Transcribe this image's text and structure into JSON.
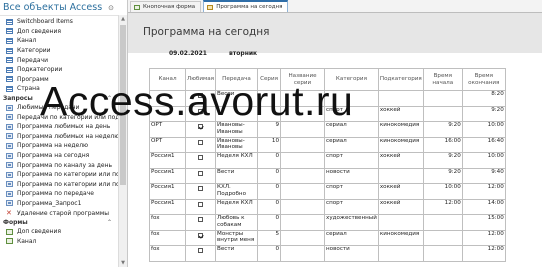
{
  "nav": {
    "header": "Все объекты Access",
    "items_top": [
      {
        "label": "Switchboard Items",
        "icon": "table-icon"
      },
      {
        "label": "Доп сведения",
        "icon": "table-icon"
      },
      {
        "label": "Канал",
        "icon": "table-icon"
      },
      {
        "label": "Категории",
        "icon": "table-icon"
      },
      {
        "label": "Передачи",
        "icon": "table-icon"
      },
      {
        "label": "Подкатегории",
        "icon": "table-icon"
      },
      {
        "label": "Программ",
        "icon": "table-icon"
      },
      {
        "label": "Страна",
        "icon": "table-icon"
      }
    ],
    "group_queries": "Запросы",
    "queries": [
      {
        "label": "Любимые передачи",
        "icon": "query-icon"
      },
      {
        "label": "Передачи по категории или подкате...",
        "icon": "query-icon"
      },
      {
        "label": "Программа любимых на день",
        "icon": "query-icon"
      },
      {
        "label": "Программа любимых на неделю",
        "icon": "query-icon"
      },
      {
        "label": "Программа на неделю",
        "icon": "query-icon"
      },
      {
        "label": "Программа на сегодня",
        "icon": "query-icon"
      },
      {
        "label": "Программа по каналу за день",
        "icon": "query-icon"
      },
      {
        "label": "Программа по категории или подкат...",
        "icon": "query-icon"
      },
      {
        "label": "Программа по категории или подкат...",
        "icon": "query-icon"
      },
      {
        "label": "Программа по передаче",
        "icon": "query-icon"
      },
      {
        "label": "Программа_Запрос1",
        "icon": "query-icon"
      },
      {
        "label": "Удаление старой программы",
        "icon": "delete-query-icon"
      }
    ],
    "group_forms": "Формы",
    "forms": [
      {
        "label": "Доп сведения",
        "icon": "form-icon"
      },
      {
        "label": "Канал",
        "icon": "form-icon"
      }
    ]
  },
  "tabs": [
    {
      "label": "Кнопочная форма",
      "active": false
    },
    {
      "label": "Программа на сегодня",
      "active": true
    }
  ],
  "form": {
    "title": "Программа на сегодня",
    "date": "09.02.2021",
    "day": "вторник"
  },
  "grid": {
    "headers": [
      "Канал",
      "Любимая",
      "Передача",
      "Серия",
      "Название серии",
      "Категория",
      "Подкатегория",
      "Время начала",
      "Время окончания"
    ],
    "rows": [
      {
        "channel": "",
        "fav": false,
        "show": "Вести",
        "episode": "",
        "episode_name": "",
        "category": "",
        "subcategory": "",
        "start": "",
        "end": "8:20"
      },
      {
        "channel": "",
        "fav": true,
        "show": "",
        "episode": "",
        "episode_name": "",
        "category": "спорт",
        "subcategory": "хоккей",
        "start": "",
        "end": "9:20"
      },
      {
        "channel": "ОРТ",
        "fav": true,
        "show": "Ивановы-Ивановы",
        "episode": "9",
        "episode_name": "",
        "category": "сериал",
        "subcategory": "кинокомедия",
        "start": "9:20",
        "end": "10:00"
      },
      {
        "channel": "ОРТ",
        "fav": false,
        "show": "Ивановы-Ивановы",
        "episode": "10",
        "episode_name": "",
        "category": "сериал",
        "subcategory": "кинокомедия",
        "start": "16:00",
        "end": "16:40"
      },
      {
        "channel": "Россия1",
        "fav": false,
        "show": "Неделя КХЛ",
        "episode": "0",
        "episode_name": "",
        "category": "спорт",
        "subcategory": "хоккей",
        "start": "9:20",
        "end": "10:00"
      },
      {
        "channel": "Россия1",
        "fav": false,
        "show": "Вести",
        "episode": "0",
        "episode_name": "",
        "category": "новости",
        "subcategory": "",
        "start": "9:20",
        "end": "9:40"
      },
      {
        "channel": "Россия1",
        "fav": false,
        "show": "КХЛ. Подробно",
        "episode": "0",
        "episode_name": "",
        "category": "спорт",
        "subcategory": "хоккей",
        "start": "10:00",
        "end": "12:00"
      },
      {
        "channel": "Россия1",
        "fav": false,
        "show": "Неделя КХЛ",
        "episode": "0",
        "episode_name": "",
        "category": "спорт",
        "subcategory": "хоккей",
        "start": "12:00",
        "end": "14:00"
      },
      {
        "channel": "fox",
        "fav": false,
        "show": "Любовь к собакам",
        "episode": "0",
        "episode_name": "",
        "category": "художественный",
        "subcategory": "",
        "start": "",
        "end": "15:00"
      },
      {
        "channel": "fox",
        "fav": true,
        "show": "Монстры внутри меня",
        "episode": "5",
        "episode_name": "",
        "category": "сериал",
        "subcategory": "кинокомедия",
        "start": "",
        "end": "12:00"
      },
      {
        "channel": "fox",
        "fav": false,
        "show": "Вести",
        "episode": "0",
        "episode_name": "",
        "category": "новости",
        "subcategory": "",
        "start": "",
        "end": "12:00"
      }
    ]
  },
  "watermark": "Access.avorut.ru"
}
